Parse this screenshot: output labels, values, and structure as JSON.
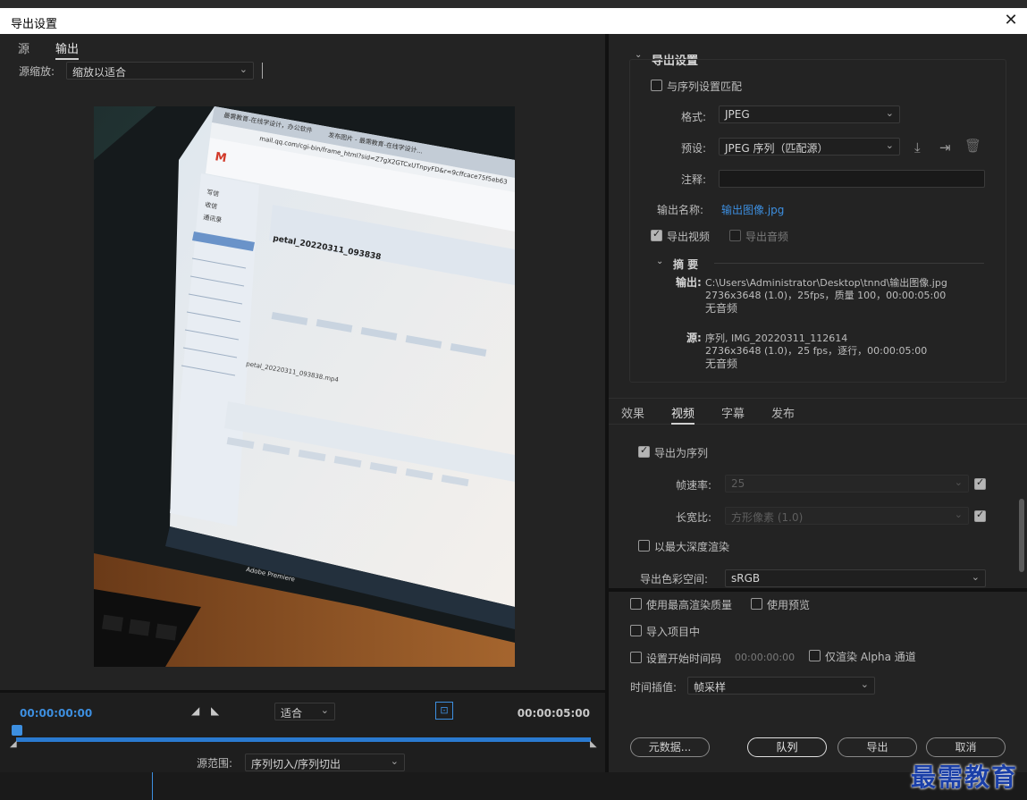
{
  "window": {
    "title": "导出设置"
  },
  "left": {
    "tabs": [
      "源",
      "输出"
    ],
    "active_tab": "输出",
    "scale_label": "源缩放:",
    "scale_value": "缩放以适合",
    "timeline": {
      "start_tc": "00:00:00:00",
      "end_tc": "00:00:05:00",
      "fit_value": "适合",
      "range_label": "源范围:",
      "range_value": "序列切入/序列切出"
    }
  },
  "export_settings": {
    "header": "导出设置",
    "match_sequence": "与序列设置匹配",
    "format_label": "格式:",
    "format_value": "JPEG",
    "preset_label": "预设:",
    "preset_value": "JPEG 序列（匹配源）",
    "comment_label": "注释:",
    "output_name_label": "输出名称:",
    "output_name_value": "输出图像.jpg",
    "export_video": "导出视频",
    "export_audio": "导出音频",
    "summary_header": "摘 要",
    "summary": {
      "output_label": "输出:",
      "output_line1": "C:\\Users\\Administrator\\Desktop\\tnnd\\输出图像.jpg",
      "output_line2": "2736x3648 (1.0)，25fps，质量 100，00:00:05:00",
      "output_line3": "无音频",
      "source_label": "源:",
      "source_line1": "序列, IMG_20220311_112614",
      "source_line2": "2736x3648 (1.0)，25 fps，逐行，00:00:05:00",
      "source_line3": "无音频"
    }
  },
  "right_tabs": [
    "效果",
    "视频",
    "字幕",
    "发布"
  ],
  "active_right_tab": "视频",
  "video": {
    "export_as_sequence": "导出为序列",
    "frame_rate_label": "帧速率:",
    "frame_rate_value": "25",
    "aspect_label": "长宽比:",
    "aspect_value": "方形像素 (1.0)",
    "max_depth": "以最大深度渲染",
    "color_space_label": "导出色彩空间:",
    "color_space_value": "sRGB"
  },
  "options": {
    "max_quality": "使用最高渲染质量",
    "use_preview": "使用预览",
    "import_project": "导入项目中",
    "set_start_tc": "设置开始时间码",
    "start_tc_value": "00:00:00:00",
    "alpha_only": "仅渲染 Alpha 通道",
    "interp_label": "时间插值:",
    "interp_value": "帧采样"
  },
  "buttons": {
    "metadata": "元数据...",
    "queue": "队列",
    "export": "导出",
    "cancel": "取消"
  },
  "watermark": "最需教育",
  "preview_text": {
    "tab1": "最需教育-在线学设计，办公软件",
    "tab2": "Win10系统安装Dr...",
    "tab3": "发布图片 - 最需教育-在线学设计...",
    "url": "mail.qq.com/cgi-bin/frame_html?sid=Z7gX2GTCxUTnpyFD&r=9cffcace75f5eb63",
    "folder1": "写信",
    "folder2": "收信",
    "folder3": "通讯录",
    "email_subject": "petal_20220311_093838",
    "attachment": "petal_20220311_093838.mp4",
    "taskbar": "Adobe Premiere"
  }
}
